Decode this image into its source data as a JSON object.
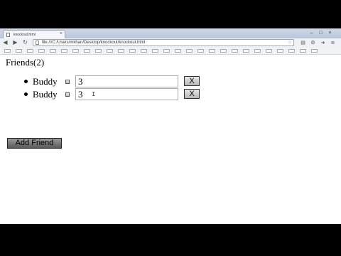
{
  "browser": {
    "tab_title": "knockout.html",
    "tab_close": "×",
    "address": "file:///C:/Users/mkhan/Desktop/knockout/knockout.html",
    "window_controls": [
      "–",
      "□",
      "×"
    ],
    "nav_icons": [
      "back-icon",
      "forward-icon",
      "reload-icon"
    ],
    "toolbar_icons": [
      "wrench-icon",
      "page-icon",
      "tools-icon",
      "menu-icon"
    ]
  },
  "page": {
    "heading": "Friends(2)",
    "friends": [
      {
        "name": "Buddy",
        "value": "3",
        "delete_label": "X"
      },
      {
        "name": "Buddy",
        "value": "3",
        "delete_label": "X"
      }
    ],
    "add_button": "Add Friend"
  },
  "colors": {
    "letterbox": "#000000",
    "page_bg": "#ffffff",
    "chrome_bg": "#eef1f6",
    "tabstrip_bg": "#c4cfe0"
  }
}
